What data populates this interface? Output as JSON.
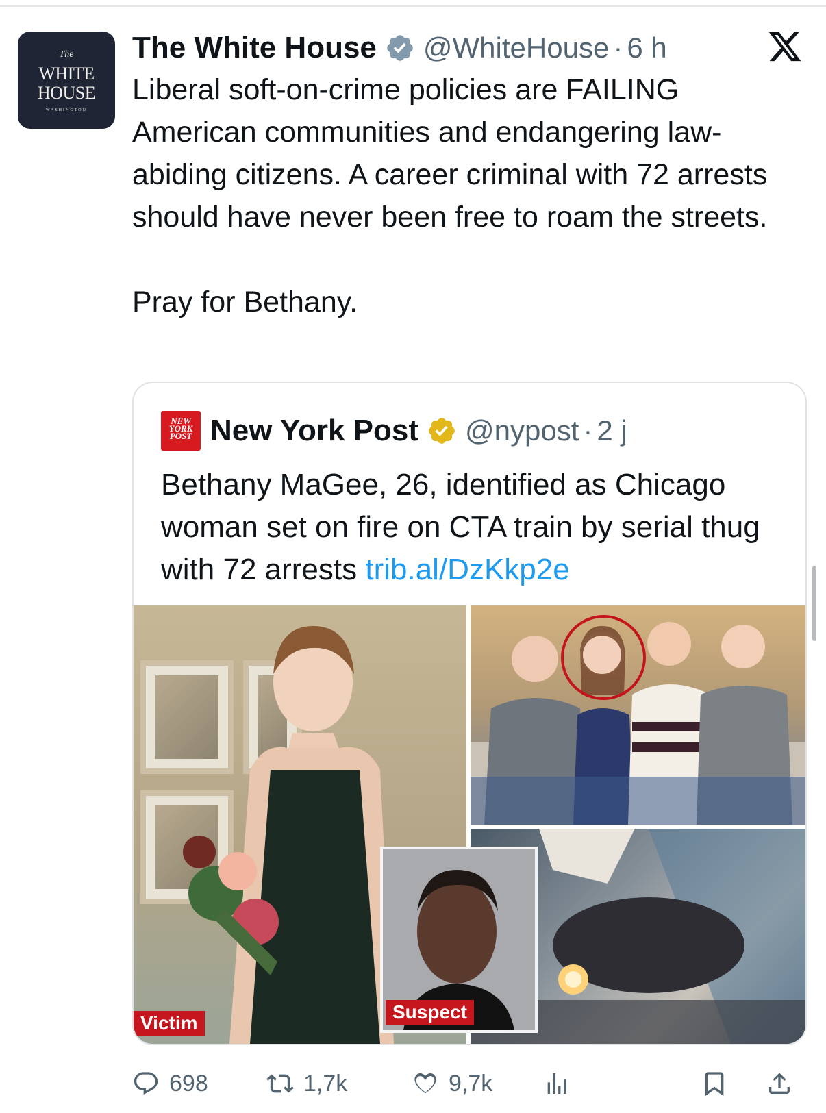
{
  "tweet": {
    "author": {
      "display_name": "The White House",
      "handle": "@WhiteHouse",
      "separator": "·",
      "time": "6 h",
      "avatar_text": {
        "line1": "The",
        "line2": "WHITE",
        "line3": "HOUSE",
        "line4": "WASHINGTON"
      },
      "verified_color": "#829aab"
    },
    "text": [
      "Liberal soft-on-crime policies are FAILING American communities and endangering law-abiding citizens. A career criminal with 72 arrests should have never been free to roam the streets.",
      "Pray for Bethany."
    ],
    "x_logo_icon": "x-logo-icon"
  },
  "quote": {
    "author": {
      "display_name": "New York Post",
      "handle": "@nypost",
      "separator": "·",
      "time": "2 j",
      "logo_text": {
        "line1": "NEW",
        "line2": "YORK",
        "line3": "POST"
      },
      "verified_color": "#e2b719"
    },
    "text": "Bethany MaGee, 26, identified as Chicago woman set on fire on CTA train by serial thug with 72 arrests ",
    "link": "trib.al/DzKkp2e",
    "media": {
      "labels": {
        "victim": "Victim",
        "suspect": "Suspect"
      },
      "label_color": "#c4161c"
    }
  },
  "actions": {
    "replies": "698",
    "reposts": "1,7k",
    "likes": "9,7k",
    "views": "",
    "icons": [
      "reply-icon",
      "repost-icon",
      "like-icon",
      "views-icon",
      "bookmark-icon",
      "share-icon"
    ]
  }
}
